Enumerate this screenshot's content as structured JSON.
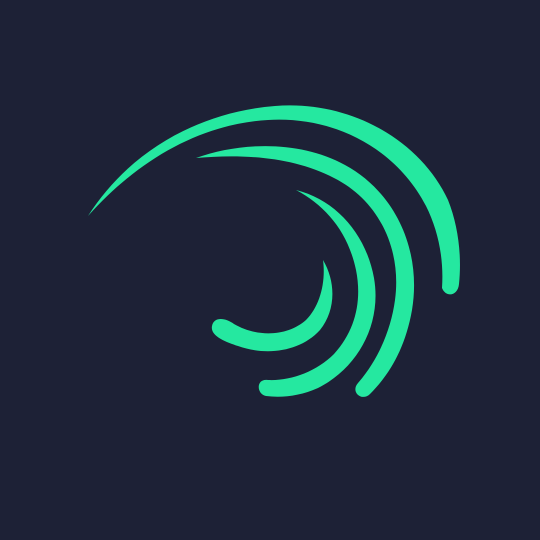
{
  "logo": {
    "icon": "alight-motion-swirl-logo",
    "colors": {
      "background": "#1d2136",
      "arc": "#25e8a0",
      "arc_tail": "#27c99a"
    }
  }
}
